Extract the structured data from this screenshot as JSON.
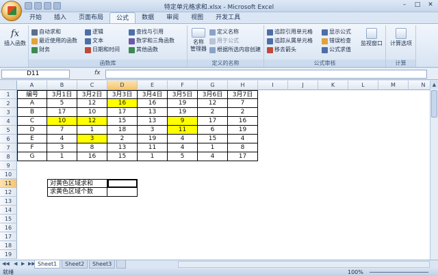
{
  "window": {
    "title": "特定单元格求和.xlsx - Microsoft Excel",
    "min_glyph": "–",
    "max_glyph": "□",
    "close_glyph": "✕"
  },
  "ribbon_tabs": [
    "开始",
    "插入",
    "页面布局",
    "公式",
    "数据",
    "审阅",
    "视图",
    "开发工具"
  ],
  "active_tab": "公式",
  "ribbon": {
    "insert_function": "插入函数",
    "fx_glyph": "fx",
    "function_library": {
      "label": "函数库",
      "autosum": "自动求和",
      "recent": "最近使用的函数",
      "financial": "财务",
      "logical": "逻辑",
      "text": "文本",
      "datetime": "日期和时间",
      "lookup": "查找与引用",
      "math": "数学和三角函数",
      "more": "其他函数"
    },
    "defined_names": {
      "label": "定义的名称",
      "name_manager_1": "名称",
      "name_manager_2": "管理器",
      "define_name": "定义名称",
      "use_in_formula": "用于公式",
      "create_from_selection": "根据所选内容创建"
    },
    "formula_auditing": {
      "label": "公式审核",
      "trace_precedents": "追踪引用单元格",
      "trace_dependents": "追踪从属单元格",
      "remove_arrows": "移去箭头",
      "show_formulas": "显示公式",
      "error_checking": "错误检查",
      "evaluate": "公式求值",
      "watch_window": "监视窗口"
    },
    "calculation": {
      "label": "计算",
      "options": "计算选项"
    }
  },
  "formula_bar": {
    "name_box": "D11",
    "fx": "fx",
    "value": ""
  },
  "columns": [
    "A",
    "B",
    "C",
    "D",
    "E",
    "F",
    "G",
    "H",
    "I",
    "J",
    "K",
    "L",
    "M",
    "N"
  ],
  "selected_column": "D",
  "rows": [
    "1",
    "2",
    "3",
    "4",
    "5",
    "6",
    "7",
    "8",
    "9",
    "10",
    "11",
    "12",
    "13",
    "14",
    "15",
    "16",
    "17",
    "18",
    "19"
  ],
  "selected_row": "11",
  "table": {
    "header": [
      "编号",
      "3月1日",
      "3月2日",
      "3月3日",
      "3月4日",
      "3月5日",
      "3月6日",
      "3月7日"
    ],
    "data": [
      [
        "A",
        "5",
        "12",
        "16",
        "16",
        "19",
        "12",
        "7"
      ],
      [
        "B",
        "17",
        "10",
        "17",
        "13",
        "19",
        "2",
        "2"
      ],
      [
        "C",
        "10",
        "12",
        "15",
        "13",
        "9",
        "17",
        "16"
      ],
      [
        "D",
        "7",
        "1",
        "18",
        "3",
        "11",
        "6",
        "19"
      ],
      [
        "E",
        "4",
        "3",
        "2",
        "19",
        "4",
        "15",
        "4"
      ],
      [
        "F",
        "3",
        "8",
        "13",
        "11",
        "4",
        "1",
        "8"
      ],
      [
        "G",
        "1",
        "16",
        "15",
        "1",
        "5",
        "4",
        "17"
      ]
    ],
    "highlight_color": "#ffff00"
  },
  "labels": {
    "sum_label": "对黄色区域求和",
    "count_label": "求黄色区域个数"
  },
  "sheet_tabs": [
    "Sheet1",
    "Sheet2",
    "Sheet3"
  ],
  "active_sheet": "Sheet1",
  "status": {
    "ready": "就绪",
    "zoom": "100%"
  }
}
